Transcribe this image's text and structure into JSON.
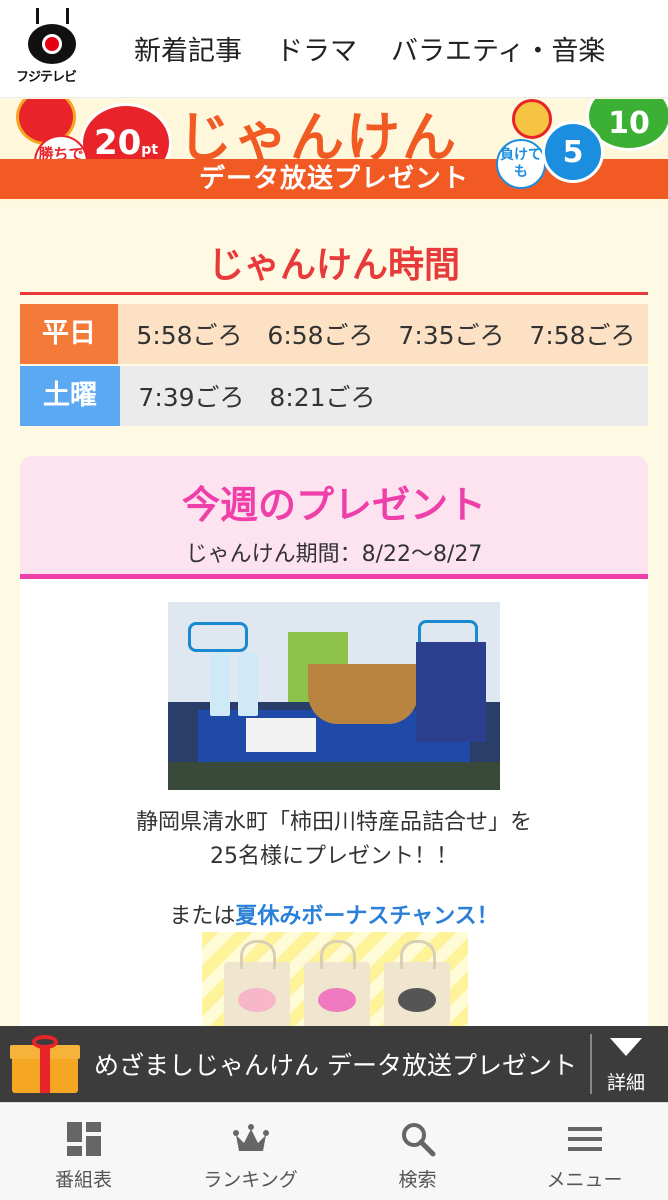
{
  "header": {
    "logo_text": "フジテレビ",
    "nav": [
      {
        "label": "新着記事"
      },
      {
        "label": "ドラマ"
      },
      {
        "label": "バラエティ・音楽"
      }
    ]
  },
  "banner": {
    "title": "じゃんけん",
    "subtitle": "データ放送プレゼント",
    "win_label": "勝ちで",
    "win_points": "20",
    "points_unit": "pt",
    "lose_label": "負けても",
    "lose_points": "5",
    "draw_points": "10"
  },
  "schedule": {
    "title": "じゃんけん時間",
    "rows": [
      {
        "day": "平日",
        "times": [
          "5:58ごろ",
          "6:58ごろ",
          "7:35ごろ",
          "7:58ごろ"
        ]
      },
      {
        "day": "土曜",
        "times": [
          "7:39ごろ",
          "8:21ごろ"
        ]
      }
    ]
  },
  "present": {
    "title": "今週のプレゼント",
    "period": "じゃんけん期間：8/22〜8/27",
    "description_line1": "静岡県清水町「柿田川特産品詰合せ」を",
    "description_line2": "25名様にプレゼント！！",
    "bonus_prefix": "または",
    "bonus_link": "夏休みボーナスチャンス！"
  },
  "notice": {
    "text": "めざましじゃんけん データ放送プレゼント",
    "more_label": "詳細"
  },
  "tabbar": {
    "tabs": [
      {
        "label": "番組表",
        "icon": "grid-icon"
      },
      {
        "label": "ランキング",
        "icon": "crown-icon"
      },
      {
        "label": "検索",
        "icon": "search-icon"
      },
      {
        "label": "メニュー",
        "icon": "menu-icon"
      }
    ]
  },
  "colors": {
    "accent_orange": "#f15a22",
    "schedule_red": "#e83a3a",
    "present_pink": "#ef3fa8",
    "weekday": "#f47a3a",
    "saturday": "#5ba9f2",
    "link_blue": "#2a7fd8"
  }
}
